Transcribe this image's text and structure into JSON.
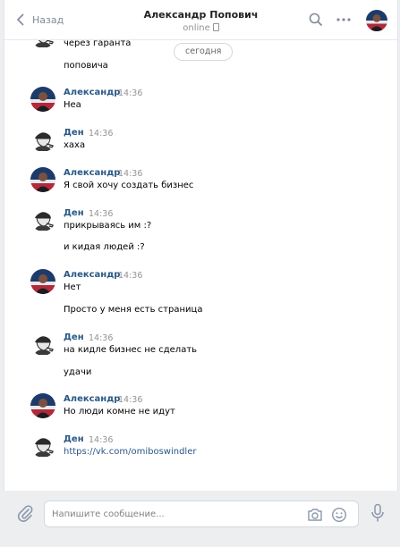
{
  "header": {
    "back_label": "Назад",
    "contact_name": "Александр Попович",
    "status": "online"
  },
  "date_separator": "сегодня",
  "messages": [
    {
      "text": "через гаранта"
    },
    {
      "text": "поповича"
    },
    {
      "author": "Александр",
      "time": "14:36",
      "text": "Неа"
    },
    {
      "author": "Ден",
      "time": "14:36",
      "text": "хаха"
    },
    {
      "author": "Александр",
      "time": "14:36",
      "text": "Я свой хочу создать бизнес"
    },
    {
      "author": "Ден",
      "time": "14:36",
      "text": "прикрываясь им :?"
    },
    {
      "text": "и кидая людей :?"
    },
    {
      "author": "Александр",
      "time": "14:36",
      "text": "Нет"
    },
    {
      "text": "Просто у меня есть страница"
    },
    {
      "author": "Ден",
      "time": "14:36",
      "text": "на кидле бизнес не сделать"
    },
    {
      "text": "удачи"
    },
    {
      "author": "Александр",
      "time": "14:36",
      "text": "Но люди комне не идут"
    },
    {
      "author": "Ден",
      "time": "14:36",
      "text": "https://vk.com/omiboswindler"
    }
  ],
  "composer": {
    "placeholder": "Напишите сообщение...",
    "value": ""
  },
  "icons": {
    "back": "chevron-left-icon",
    "search": "search-icon",
    "more": "more-dots-icon",
    "attach": "paperclip-icon",
    "camera": "camera-icon",
    "emoji": "smile-icon",
    "voice": "microphone-icon"
  },
  "colors": {
    "link": "#2a5885",
    "muted": "#939393",
    "background": "#edeef0"
  }
}
